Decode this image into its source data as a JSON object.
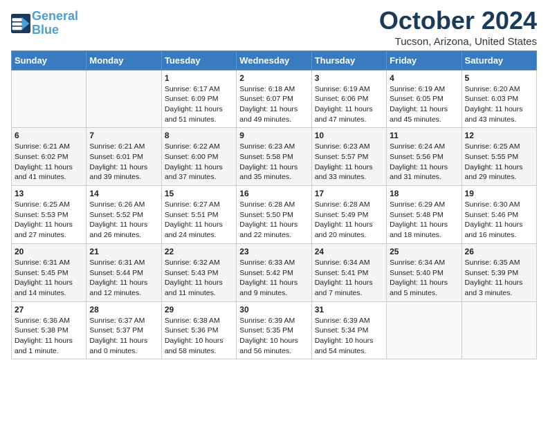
{
  "logo": {
    "line1": "General",
    "line2": "Blue"
  },
  "title": "October 2024",
  "location": "Tucson, Arizona, United States",
  "days_of_week": [
    "Sunday",
    "Monday",
    "Tuesday",
    "Wednesday",
    "Thursday",
    "Friday",
    "Saturday"
  ],
  "weeks": [
    [
      {
        "day": "",
        "sunrise": "",
        "sunset": "",
        "daylight": ""
      },
      {
        "day": "",
        "sunrise": "",
        "sunset": "",
        "daylight": ""
      },
      {
        "day": "1",
        "sunrise": "Sunrise: 6:17 AM",
        "sunset": "Sunset: 6:09 PM",
        "daylight": "Daylight: 11 hours and 51 minutes."
      },
      {
        "day": "2",
        "sunrise": "Sunrise: 6:18 AM",
        "sunset": "Sunset: 6:07 PM",
        "daylight": "Daylight: 11 hours and 49 minutes."
      },
      {
        "day": "3",
        "sunrise": "Sunrise: 6:19 AM",
        "sunset": "Sunset: 6:06 PM",
        "daylight": "Daylight: 11 hours and 47 minutes."
      },
      {
        "day": "4",
        "sunrise": "Sunrise: 6:19 AM",
        "sunset": "Sunset: 6:05 PM",
        "daylight": "Daylight: 11 hours and 45 minutes."
      },
      {
        "day": "5",
        "sunrise": "Sunrise: 6:20 AM",
        "sunset": "Sunset: 6:03 PM",
        "daylight": "Daylight: 11 hours and 43 minutes."
      }
    ],
    [
      {
        "day": "6",
        "sunrise": "Sunrise: 6:21 AM",
        "sunset": "Sunset: 6:02 PM",
        "daylight": "Daylight: 11 hours and 41 minutes."
      },
      {
        "day": "7",
        "sunrise": "Sunrise: 6:21 AM",
        "sunset": "Sunset: 6:01 PM",
        "daylight": "Daylight: 11 hours and 39 minutes."
      },
      {
        "day": "8",
        "sunrise": "Sunrise: 6:22 AM",
        "sunset": "Sunset: 6:00 PM",
        "daylight": "Daylight: 11 hours and 37 minutes."
      },
      {
        "day": "9",
        "sunrise": "Sunrise: 6:23 AM",
        "sunset": "Sunset: 5:58 PM",
        "daylight": "Daylight: 11 hours and 35 minutes."
      },
      {
        "day": "10",
        "sunrise": "Sunrise: 6:23 AM",
        "sunset": "Sunset: 5:57 PM",
        "daylight": "Daylight: 11 hours and 33 minutes."
      },
      {
        "day": "11",
        "sunrise": "Sunrise: 6:24 AM",
        "sunset": "Sunset: 5:56 PM",
        "daylight": "Daylight: 11 hours and 31 minutes."
      },
      {
        "day": "12",
        "sunrise": "Sunrise: 6:25 AM",
        "sunset": "Sunset: 5:55 PM",
        "daylight": "Daylight: 11 hours and 29 minutes."
      }
    ],
    [
      {
        "day": "13",
        "sunrise": "Sunrise: 6:25 AM",
        "sunset": "Sunset: 5:53 PM",
        "daylight": "Daylight: 11 hours and 27 minutes."
      },
      {
        "day": "14",
        "sunrise": "Sunrise: 6:26 AM",
        "sunset": "Sunset: 5:52 PM",
        "daylight": "Daylight: 11 hours and 26 minutes."
      },
      {
        "day": "15",
        "sunrise": "Sunrise: 6:27 AM",
        "sunset": "Sunset: 5:51 PM",
        "daylight": "Daylight: 11 hours and 24 minutes."
      },
      {
        "day": "16",
        "sunrise": "Sunrise: 6:28 AM",
        "sunset": "Sunset: 5:50 PM",
        "daylight": "Daylight: 11 hours and 22 minutes."
      },
      {
        "day": "17",
        "sunrise": "Sunrise: 6:28 AM",
        "sunset": "Sunset: 5:49 PM",
        "daylight": "Daylight: 11 hours and 20 minutes."
      },
      {
        "day": "18",
        "sunrise": "Sunrise: 6:29 AM",
        "sunset": "Sunset: 5:48 PM",
        "daylight": "Daylight: 11 hours and 18 minutes."
      },
      {
        "day": "19",
        "sunrise": "Sunrise: 6:30 AM",
        "sunset": "Sunset: 5:46 PM",
        "daylight": "Daylight: 11 hours and 16 minutes."
      }
    ],
    [
      {
        "day": "20",
        "sunrise": "Sunrise: 6:31 AM",
        "sunset": "Sunset: 5:45 PM",
        "daylight": "Daylight: 11 hours and 14 minutes."
      },
      {
        "day": "21",
        "sunrise": "Sunrise: 6:31 AM",
        "sunset": "Sunset: 5:44 PM",
        "daylight": "Daylight: 11 hours and 12 minutes."
      },
      {
        "day": "22",
        "sunrise": "Sunrise: 6:32 AM",
        "sunset": "Sunset: 5:43 PM",
        "daylight": "Daylight: 11 hours and 11 minutes."
      },
      {
        "day": "23",
        "sunrise": "Sunrise: 6:33 AM",
        "sunset": "Sunset: 5:42 PM",
        "daylight": "Daylight: 11 hours and 9 minutes."
      },
      {
        "day": "24",
        "sunrise": "Sunrise: 6:34 AM",
        "sunset": "Sunset: 5:41 PM",
        "daylight": "Daylight: 11 hours and 7 minutes."
      },
      {
        "day": "25",
        "sunrise": "Sunrise: 6:34 AM",
        "sunset": "Sunset: 5:40 PM",
        "daylight": "Daylight: 11 hours and 5 minutes."
      },
      {
        "day": "26",
        "sunrise": "Sunrise: 6:35 AM",
        "sunset": "Sunset: 5:39 PM",
        "daylight": "Daylight: 11 hours and 3 minutes."
      }
    ],
    [
      {
        "day": "27",
        "sunrise": "Sunrise: 6:36 AM",
        "sunset": "Sunset: 5:38 PM",
        "daylight": "Daylight: 11 hours and 1 minute."
      },
      {
        "day": "28",
        "sunrise": "Sunrise: 6:37 AM",
        "sunset": "Sunset: 5:37 PM",
        "daylight": "Daylight: 11 hours and 0 minutes."
      },
      {
        "day": "29",
        "sunrise": "Sunrise: 6:38 AM",
        "sunset": "Sunset: 5:36 PM",
        "daylight": "Daylight: 10 hours and 58 minutes."
      },
      {
        "day": "30",
        "sunrise": "Sunrise: 6:39 AM",
        "sunset": "Sunset: 5:35 PM",
        "daylight": "Daylight: 10 hours and 56 minutes."
      },
      {
        "day": "31",
        "sunrise": "Sunrise: 6:39 AM",
        "sunset": "Sunset: 5:34 PM",
        "daylight": "Daylight: 10 hours and 54 minutes."
      },
      {
        "day": "",
        "sunrise": "",
        "sunset": "",
        "daylight": ""
      },
      {
        "day": "",
        "sunrise": "",
        "sunset": "",
        "daylight": ""
      }
    ]
  ]
}
